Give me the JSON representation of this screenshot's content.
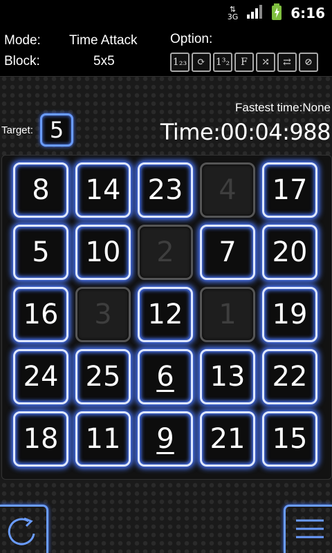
{
  "status": {
    "time": "6:16",
    "network": "3G"
  },
  "header": {
    "mode_label": "Mode:",
    "mode_value": "Time Attack",
    "block_label": "Block:",
    "block_value": "5x5",
    "option_label": "Option:"
  },
  "options": [
    {
      "name": "sequence-icon",
      "text": "1₂₃"
    },
    {
      "name": "rotate-icon",
      "text": "⟳"
    },
    {
      "name": "fraction-icon",
      "text": "1³₂"
    },
    {
      "name": "f-icon",
      "text": "F"
    },
    {
      "name": "shuffle-icon",
      "text": "⤮"
    },
    {
      "name": "swap-icon",
      "text": "⇄"
    },
    {
      "name": "disable-icon",
      "text": "⊘"
    }
  ],
  "fastest": "Fastest time:None",
  "timer": "Time:00:04:988",
  "target_label": "Target:",
  "target_value": "5",
  "grid": [
    {
      "n": "8",
      "s": "active"
    },
    {
      "n": "14",
      "s": "active"
    },
    {
      "n": "23",
      "s": "active"
    },
    {
      "n": "4",
      "s": "cleared"
    },
    {
      "n": "17",
      "s": "active"
    },
    {
      "n": "5",
      "s": "active"
    },
    {
      "n": "10",
      "s": "active"
    },
    {
      "n": "2",
      "s": "cleared"
    },
    {
      "n": "7",
      "s": "active"
    },
    {
      "n": "20",
      "s": "active"
    },
    {
      "n": "16",
      "s": "active"
    },
    {
      "n": "3",
      "s": "cleared"
    },
    {
      "n": "12",
      "s": "active"
    },
    {
      "n": "1",
      "s": "cleared"
    },
    {
      "n": "19",
      "s": "active"
    },
    {
      "n": "24",
      "s": "active"
    },
    {
      "n": "25",
      "s": "active"
    },
    {
      "n": "6",
      "s": "active",
      "u": true
    },
    {
      "n": "13",
      "s": "active"
    },
    {
      "n": "22",
      "s": "active"
    },
    {
      "n": "18",
      "s": "active"
    },
    {
      "n": "11",
      "s": "active"
    },
    {
      "n": "9",
      "s": "active",
      "u": true
    },
    {
      "n": "21",
      "s": "active"
    },
    {
      "n": "15",
      "s": "active"
    }
  ]
}
